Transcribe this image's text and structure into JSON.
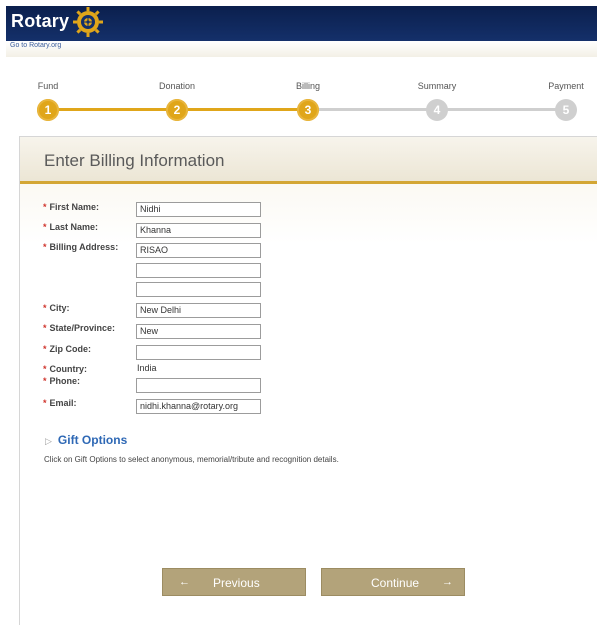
{
  "header": {
    "logo_text": "Rotary",
    "sublink": "Go to Rotary.org"
  },
  "steps": [
    {
      "label": "Fund",
      "number": "1",
      "state": "complete"
    },
    {
      "label": "Donation",
      "number": "2",
      "state": "complete"
    },
    {
      "label": "Billing",
      "number": "3",
      "state": "current"
    },
    {
      "label": "Summary",
      "number": "4",
      "state": "upcoming"
    },
    {
      "label": "Payment",
      "number": "5",
      "state": "upcoming"
    }
  ],
  "colors": {
    "accent": "#e0a61a",
    "inactive": "#cfcfcf",
    "button": "#b3a37a",
    "link": "#2e68b5"
  },
  "panel": {
    "title": "Enter Billing Information"
  },
  "form": {
    "required_mark": "*",
    "first_name": {
      "label": "First Name:",
      "value": "Nidhi"
    },
    "last_name": {
      "label": "Last Name:",
      "value": "Khanna"
    },
    "billing_address": {
      "label": "Billing Address:",
      "line1": "RISAO",
      "line2": "",
      "line3": ""
    },
    "city": {
      "label": "City:",
      "value": "New Delhi"
    },
    "state": {
      "label": "State/Province:",
      "value": "New"
    },
    "zip": {
      "label": "Zip Code:",
      "value": ""
    },
    "country": {
      "label": "Country:",
      "value": "India"
    },
    "phone": {
      "label": "Phone:",
      "value": ""
    },
    "email": {
      "label": "Email:",
      "value": "nidhi.khanna@rotary.org"
    }
  },
  "gift": {
    "toggle_label": "Gift Options",
    "description": "Click on Gift Options to select anonymous, memorial/tribute and recognition details."
  },
  "buttons": {
    "previous": "Previous",
    "continue": "Continue",
    "previous_icon": "left-arrow-icon",
    "continue_icon": "right-arrow-icon"
  }
}
